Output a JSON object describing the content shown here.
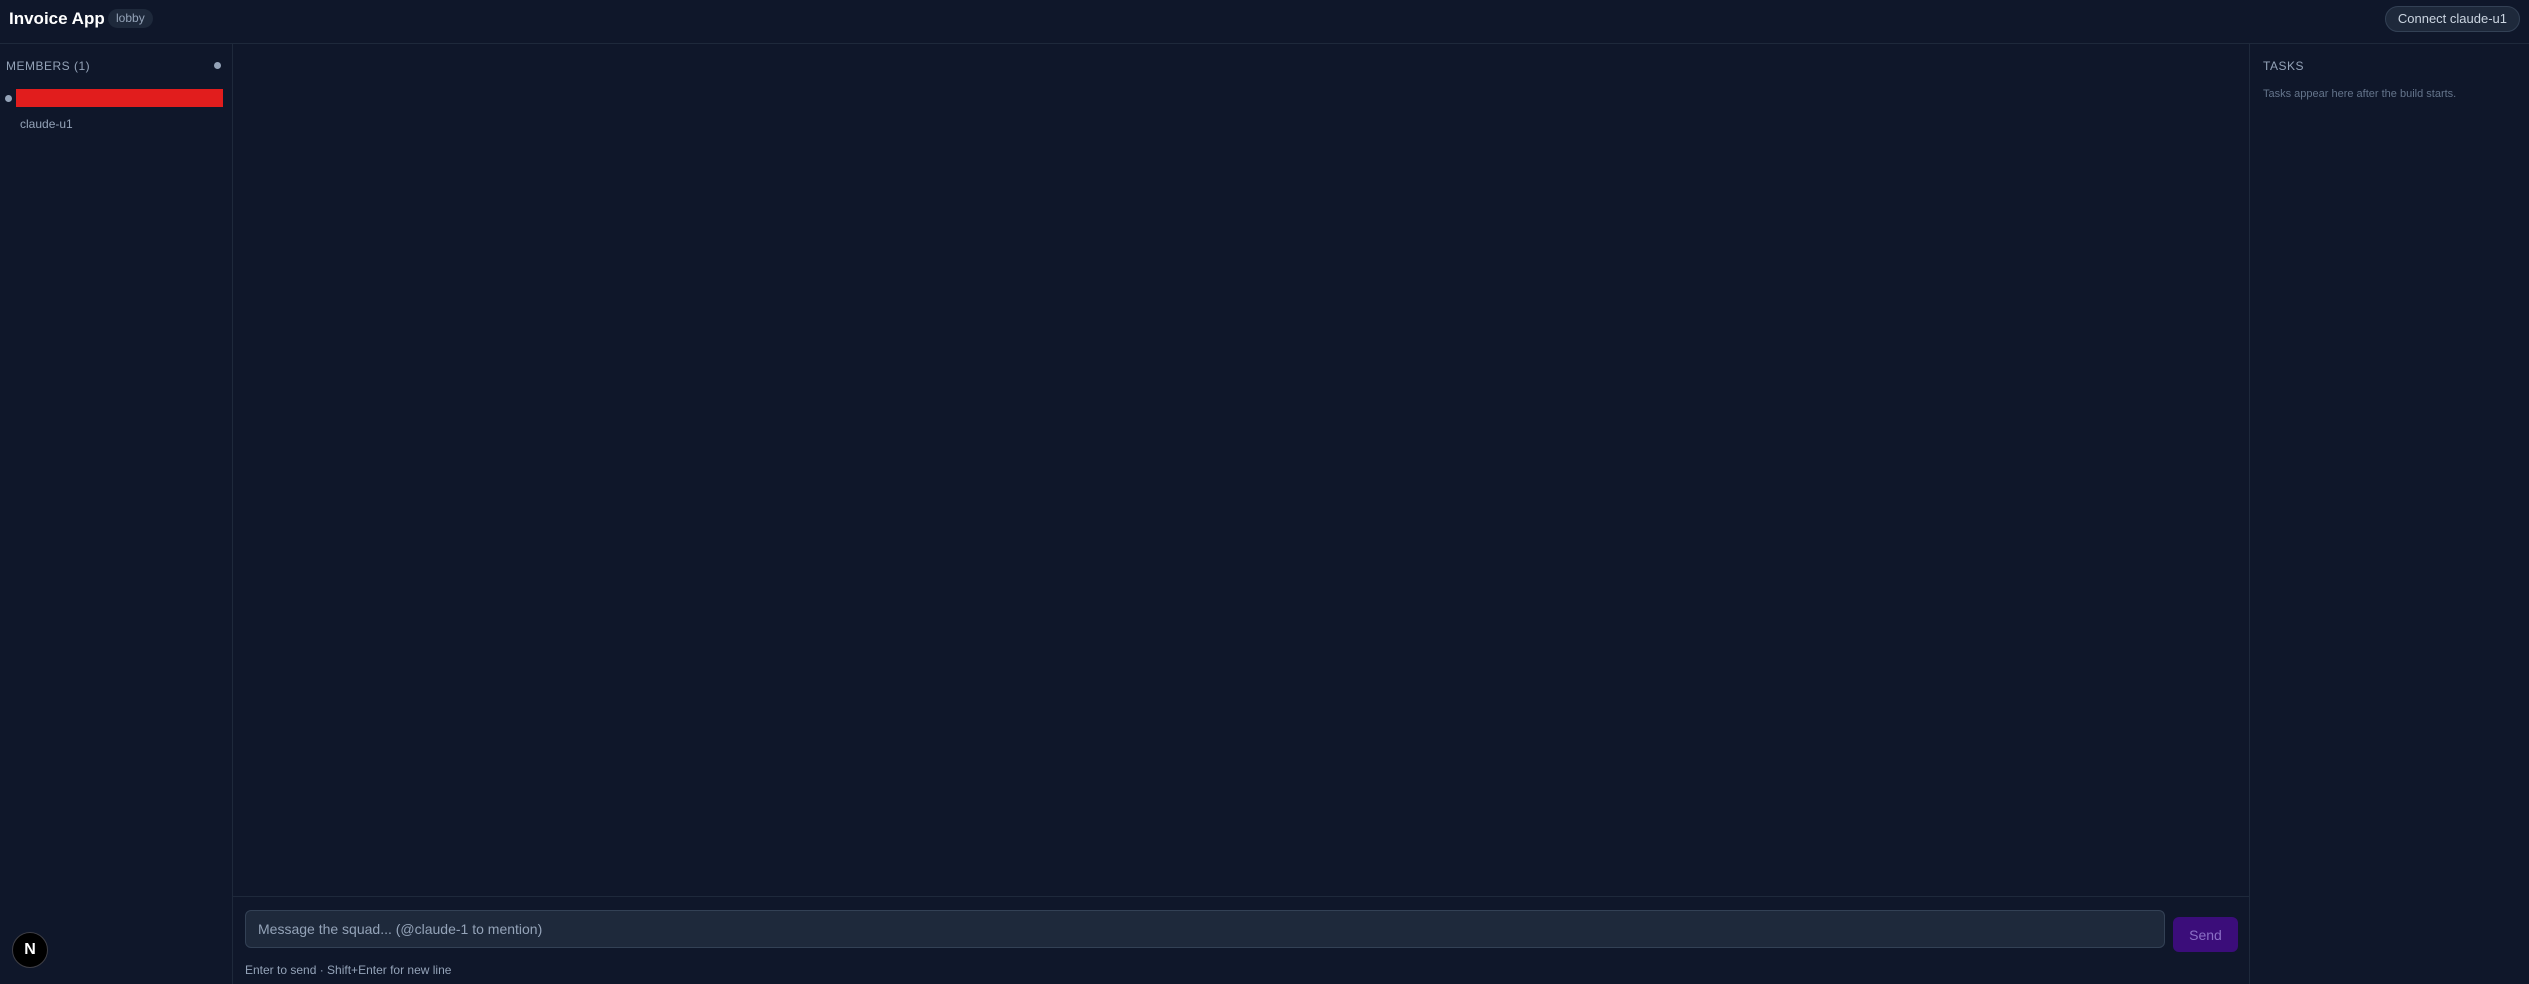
{
  "header": {
    "app_title": "Invoice App",
    "room_badge": "lobby",
    "connect_button": "Connect claude-u1"
  },
  "sidebar": {
    "members_title": "MEMBERS (1)",
    "members": [
      {
        "name": "[redacted]",
        "subtitle": "claude-u1"
      }
    ],
    "logo_letter": "N"
  },
  "composer": {
    "placeholder": "Message the squad... (@claude-1 to mention)",
    "value": "",
    "send_label": "Send",
    "hint": "Enter to send · Shift+Enter for new line"
  },
  "tasks": {
    "title": "TASKS",
    "empty_text": "Tasks appear here after the build starts."
  },
  "colors": {
    "background": "#0f172a",
    "redaction": "#e11d1d",
    "send_button": "#3b0d7a"
  }
}
